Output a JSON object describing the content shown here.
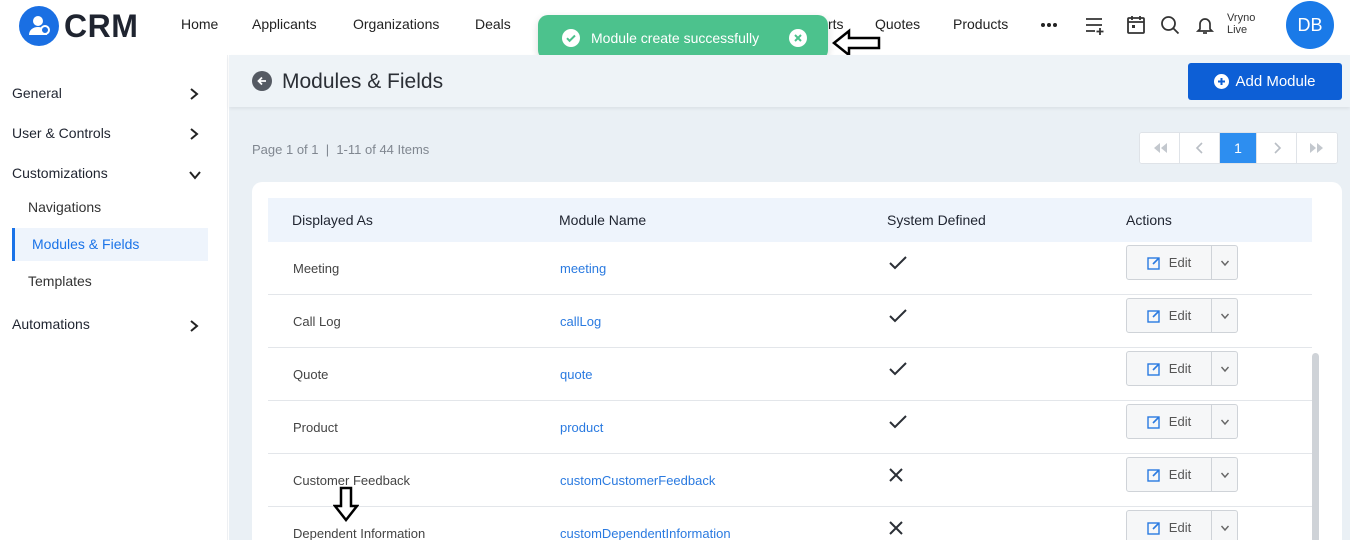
{
  "app": {
    "name": "CRM",
    "brand_color": "#1a6fe3"
  },
  "nav": {
    "items": [
      "Home",
      "Applicants",
      "Organizations",
      "Deals",
      "rts",
      "Quotes",
      "Products"
    ],
    "icons": [
      "more-icon",
      "list-add-icon",
      "calendar-icon",
      "search-icon",
      "bell-icon"
    ],
    "user_line1": "Vryno",
    "user_line2": "Live",
    "avatar_initials": "DB"
  },
  "toast": {
    "message": "Module create successfully",
    "color": "#4cc28d"
  },
  "sidebar": {
    "general": "General",
    "user_controls": "User & Controls",
    "customizations": "Customizations",
    "sub_items": [
      "Navigations",
      "Modules & Fields",
      "Templates"
    ],
    "automations": "Automations"
  },
  "page": {
    "title": "Modules & Fields",
    "add_button": "Add Module",
    "page_info": "Page 1 of 1  |  1-11 of 44 Items",
    "current_page": "1"
  },
  "table": {
    "headers": [
      "Displayed As",
      "Module Name",
      "System Defined",
      "Actions"
    ],
    "rows": [
      {
        "displayed_as": "Meeting",
        "module_name": "meeting",
        "system_defined": true
      },
      {
        "displayed_as": "Call Log",
        "module_name": "callLog",
        "system_defined": true
      },
      {
        "displayed_as": "Quote",
        "module_name": "quote",
        "system_defined": true
      },
      {
        "displayed_as": "Product",
        "module_name": "product",
        "system_defined": true
      },
      {
        "displayed_as": "Customer Feedback",
        "module_name": "customCustomerFeedback",
        "system_defined": false
      },
      {
        "displayed_as": "Dependent Information",
        "module_name": "customDependentInformation",
        "system_defined": false
      }
    ],
    "edit_label": "Edit"
  }
}
